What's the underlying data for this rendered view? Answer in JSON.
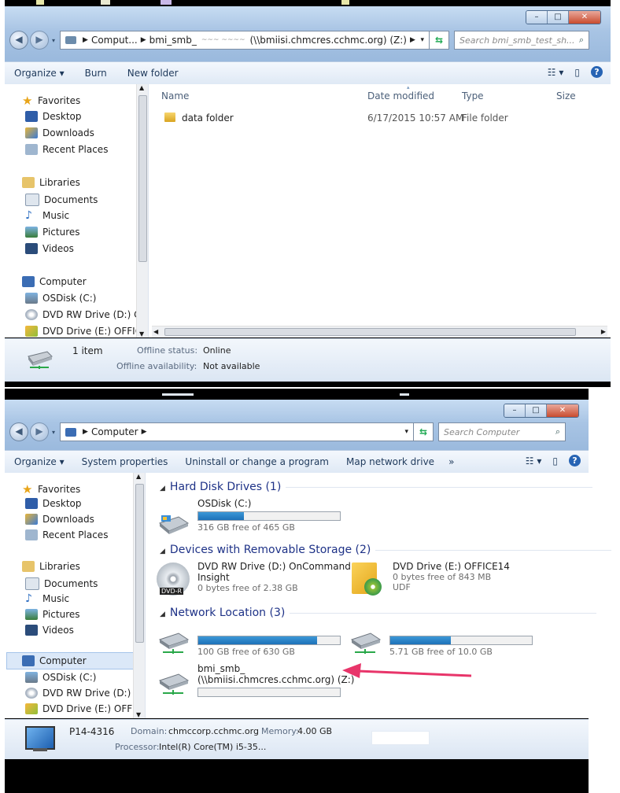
{
  "window1": {
    "address": {
      "computer": "Comput...",
      "share": "bmi_smb_",
      "redacted": "~~~ ~~~~",
      "path": "(\\\\bmiisi.chmcres.cchmc.org) (Z:)"
    },
    "search_placeholder": "Search bmi_smb_test_sh...",
    "commands": [
      "Organize ▾",
      "Burn",
      "New folder"
    ],
    "nav": {
      "favorites": "Favorites",
      "desktop": "Desktop",
      "downloads": "Downloads",
      "recent": "Recent Places",
      "libraries": "Libraries",
      "documents": "Documents",
      "music": "Music",
      "pictures": "Pictures",
      "videos": "Videos",
      "computer": "Computer",
      "osdisk": "OSDisk (C:)",
      "dvdrw": "DVD RW Drive (D:) C",
      "dvde": "DVD Drive (E:) OFFIC"
    },
    "columns": {
      "name": "Name",
      "date": "Date modified",
      "type": "Type",
      "size": "Size"
    },
    "file": {
      "name": "data folder",
      "date": "6/17/2015 10:57 AM",
      "type": "File folder"
    },
    "status": {
      "count": "1 item",
      "offline_label": "Offline status:",
      "offline_value": "Online",
      "avail_label": "Offline availability:",
      "avail_value": "Not available"
    }
  },
  "window2": {
    "address": {
      "computer": "Computer"
    },
    "search_placeholder": "Search Computer",
    "commands": [
      "Organize ▾",
      "System properties",
      "Uninstall or change a program",
      "Map network drive",
      "»"
    ],
    "nav": {
      "favorites": "Favorites",
      "desktop": "Desktop",
      "downloads": "Downloads",
      "recent": "Recent Places",
      "libraries": "Libraries",
      "documents": "Documents",
      "music": "Music",
      "pictures": "Pictures",
      "videos": "Videos",
      "computer": "Computer",
      "osdisk": "OSDisk (C:)",
      "dvdrw": "DVD RW Drive (D:) C",
      "dvde": "DVD Drive (E:) OFFIC"
    },
    "groups": {
      "hdd": "Hard Disk Drives (1)",
      "removable": "Devices with Removable Storage (2)",
      "network": "Network Location (3)"
    },
    "drives": {
      "osdisk": {
        "name": "OSDisk (C:)",
        "free": "316 GB free of 465 GB",
        "used": 0.32
      },
      "dvdrw": {
        "name": "DVD RW Drive (D:) OnCommand",
        "name2": "Insight",
        "free": "0 bytes free of 2.38 GB",
        "badge": "DVD-R"
      },
      "dvde": {
        "name": "DVD Drive (E:) OFFICE14",
        "free": "0 bytes free of 843 MB",
        "fs": "UDF"
      },
      "net1": {
        "free": "100 GB free of 630 GB",
        "used": 0.84
      },
      "net2": {
        "free": "5.71 GB free of 10.0 GB",
        "used": 0.43
      },
      "net3": {
        "name": "bmi_smb_",
        "path": "(\\\\bmiisi.chmcres.cchmc.org) (Z:)",
        "used": 0.0
      }
    },
    "status": {
      "pc": "P14-4316",
      "domain_label": "Domain:",
      "domain": "chmccorp.cchmc.org",
      "memory_label": "Memory:",
      "memory": "4.00 GB",
      "processor_label": "Processor:",
      "processor": "Intel(R) Core(TM) i5-35..."
    }
  },
  "colors": {
    "accent": "#1e3287",
    "arrow": "#e8356a",
    "bar": "#1d71b8"
  }
}
